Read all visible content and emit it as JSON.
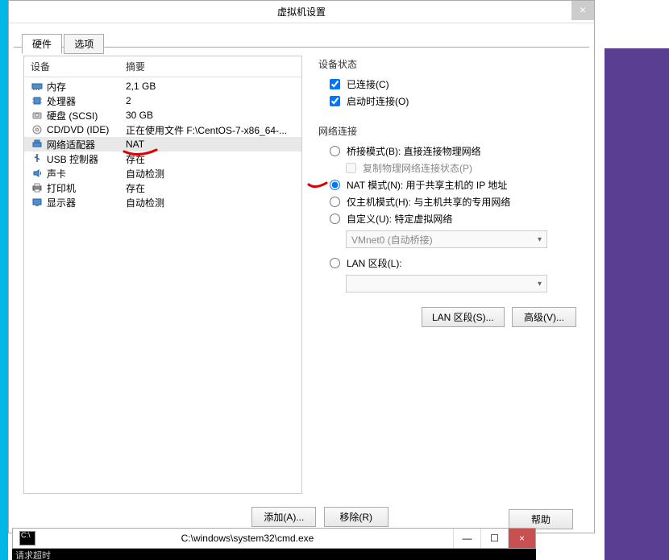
{
  "dialog": {
    "title": "虚拟机设置",
    "tabs": {
      "hardware": "硬件",
      "options": "选项"
    },
    "columns": {
      "device": "设备",
      "summary": "摘要"
    },
    "devices": [
      {
        "name": "内存",
        "summary": "2,1 GB",
        "icon": "memory"
      },
      {
        "name": "处理器",
        "summary": "2",
        "icon": "cpu"
      },
      {
        "name": "硬盘 (SCSI)",
        "summary": "30 GB",
        "icon": "disk"
      },
      {
        "name": "CD/DVD (IDE)",
        "summary": "正在使用文件 F:\\CentOS-7-x86_64-...",
        "icon": "cd"
      },
      {
        "name": "网络适配器",
        "summary": "NAT",
        "icon": "net",
        "selected": true
      },
      {
        "name": "USB 控制器",
        "summary": "存在",
        "icon": "usb"
      },
      {
        "name": "声卡",
        "summary": "自动检测",
        "icon": "sound"
      },
      {
        "name": "打印机",
        "summary": "存在",
        "icon": "printer"
      },
      {
        "name": "显示器",
        "summary": "自动检测",
        "icon": "display"
      }
    ],
    "add_btn": "添加(A)...",
    "remove_btn": "移除(R)"
  },
  "right": {
    "status_title": "设备状态",
    "connected": "已连接(C)",
    "connect_on_start": "启动时连接(O)",
    "net_title": "网络连接",
    "bridge": "桥接模式(B): 直接连接物理网络",
    "replicate": "复制物理网络连接状态(P)",
    "nat": "NAT 模式(N): 用于共享主机的 IP 地址",
    "hostonly": "仅主机模式(H): 与主机共享的专用网络",
    "custom": "自定义(U): 特定虚拟网络",
    "custom_dd": "VMnet0 (自动桥接)",
    "lan": "LAN 区段(L):",
    "lan_btn": "LAN 区段(S)...",
    "adv_btn": "高级(V)...",
    "help_btn": "帮助"
  },
  "cmd": {
    "title": "C:\\windows\\system32\\cmd.exe",
    "output": "请求超时"
  }
}
